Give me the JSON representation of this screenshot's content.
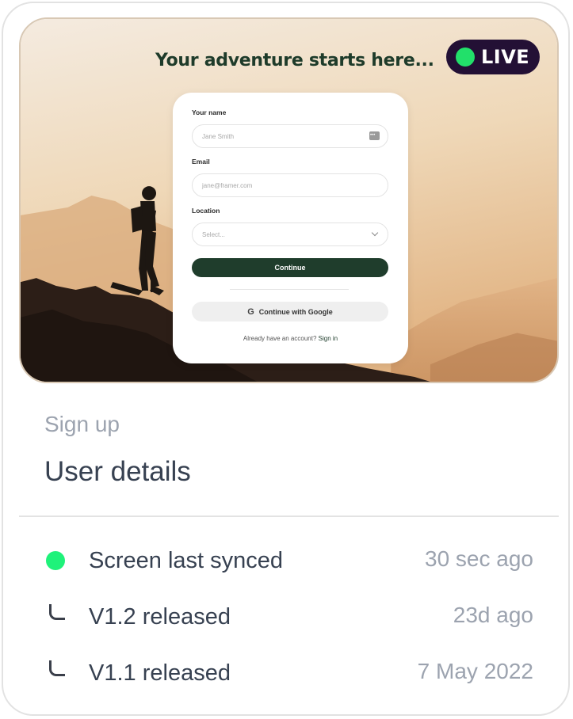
{
  "hero": {
    "headline": "Your adventure starts here...",
    "live_label": "LIVE",
    "live_color": "#22e06a"
  },
  "form": {
    "name_label": "Your name",
    "name_placeholder": "Jane Smith",
    "email_label": "Email",
    "email_placeholder": "jane@framer.com",
    "location_label": "Location",
    "location_placeholder": "Select...",
    "continue_label": "Continue",
    "google_icon": "G",
    "google_label": "Continue with Google",
    "account_prompt": "Already have an account?",
    "signin_label": "Sign in",
    "accent": "#1f3d2c"
  },
  "summary": {
    "eyebrow": "Sign up",
    "title": "User details"
  },
  "activity": [
    {
      "label": "Screen last synced",
      "time": "30 sec ago",
      "icon": "status-dot-icon"
    },
    {
      "label": "V1.2 released",
      "time": "23d ago",
      "icon": "corner-branch-icon"
    },
    {
      "label": "V1.1 released",
      "time": "7 May 2022",
      "icon": "corner-branch-icon"
    }
  ]
}
